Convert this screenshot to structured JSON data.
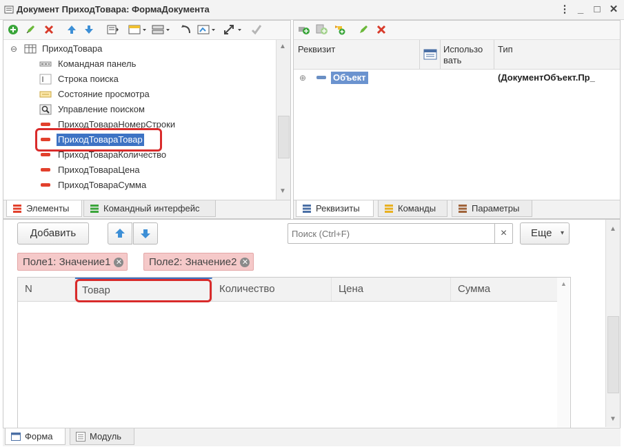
{
  "window": {
    "title": "Документ ПриходТовара: ФормаДокумента",
    "buttons": {
      "menu": "⋮",
      "minimize": "_",
      "maximize": "□",
      "close": "✕"
    }
  },
  "elements_tree": {
    "root": "ПриходТовара",
    "items": [
      {
        "label": "Командная панель",
        "icon": "command-panel-icon"
      },
      {
        "label": "Строка поиска",
        "icon": "search-string-icon"
      },
      {
        "label": "Состояние просмотра",
        "icon": "view-state-icon"
      },
      {
        "label": "Управление поиском",
        "icon": "search-control-icon"
      },
      {
        "label": "ПриходТовараНомерСтроки",
        "icon": "field-icon"
      },
      {
        "label": "ПриходТовараТовар",
        "icon": "field-icon",
        "selected": true
      },
      {
        "label": "ПриходТовараКоличество",
        "icon": "field-icon"
      },
      {
        "label": "ПриходТовараЦена",
        "icon": "field-icon"
      },
      {
        "label": "ПриходТовараСумма",
        "icon": "field-icon"
      }
    ]
  },
  "left_tabs": [
    {
      "label": "Элементы",
      "active": true
    },
    {
      "label": "Командный интерфейс",
      "active": false
    }
  ],
  "right_tabs": [
    {
      "label": "Реквизиты",
      "active": true
    },
    {
      "label": "Команды",
      "active": false
    },
    {
      "label": "Параметры",
      "active": false
    }
  ],
  "attributes": {
    "columns": {
      "name": "Реквизит",
      "use_line1": "Использо",
      "use_line2": "вать",
      "type": "Тип"
    },
    "rows": [
      {
        "name": "Объект",
        "type": "(ДокументОбъект.Пр_"
      }
    ]
  },
  "preview": {
    "add_button": "Добавить",
    "search_placeholder": "Поиск (Ctrl+F)",
    "search_clear": "×",
    "more_button": "Еще",
    "more_arrow": "▾",
    "filters": [
      {
        "label": "Поле1: Значение1"
      },
      {
        "label": "Поле2: Значение2"
      }
    ],
    "table_columns": [
      "N",
      "Товар",
      "Количество",
      "Цена",
      "Сумма"
    ]
  },
  "bottom_tabs": [
    {
      "label": "Форма",
      "active": true
    },
    {
      "label": "Модуль",
      "active": false
    }
  ],
  "colors": {
    "accent": "#3d73c4",
    "highlight_red": "#d92b2b",
    "filter_chip": "#f5c9c9",
    "add": "#3aa53a",
    "delete": "#d83a2a"
  }
}
